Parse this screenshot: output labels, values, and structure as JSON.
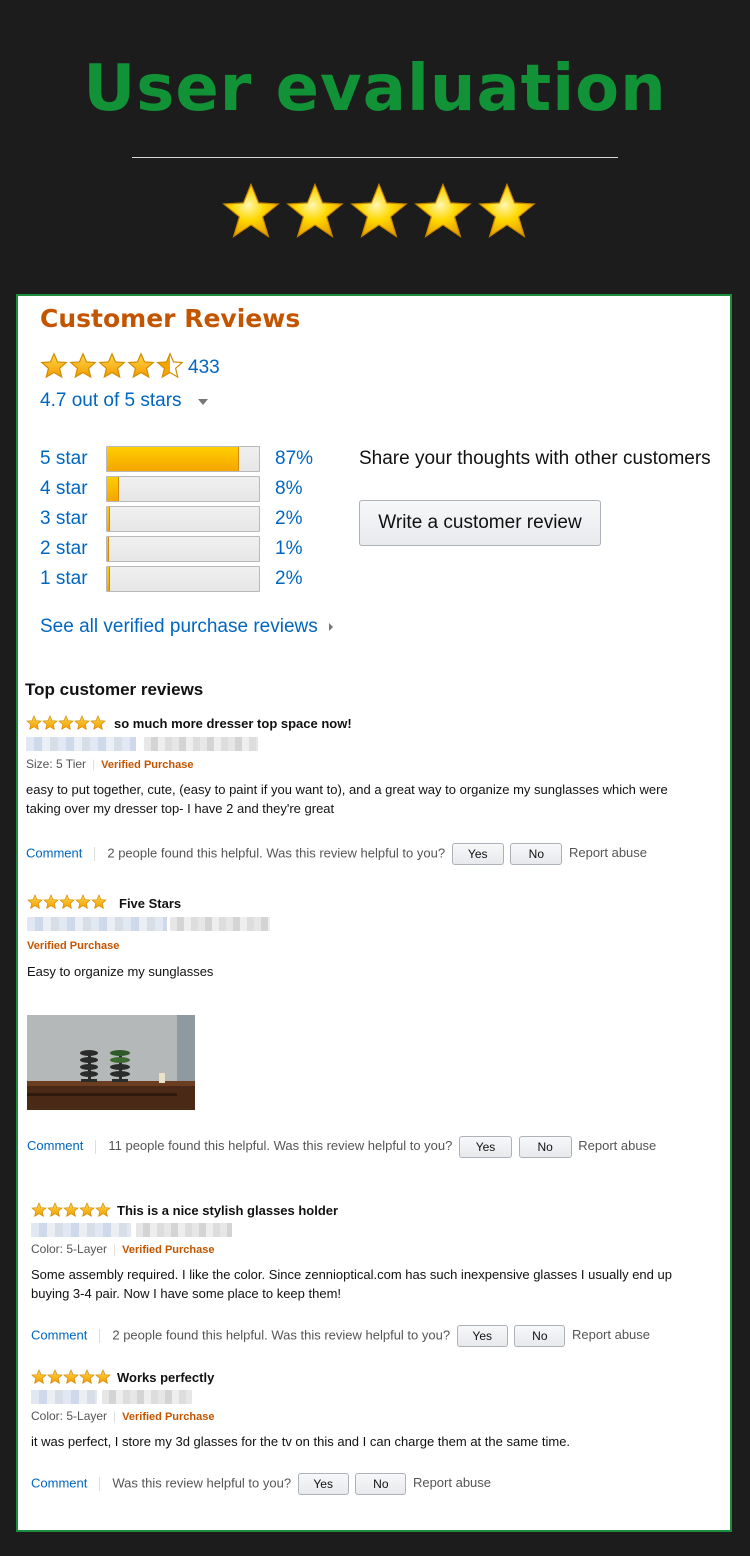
{
  "hero": {
    "title": "User evaluation",
    "star_count": 5
  },
  "reviews_section": {
    "title": "Customer Reviews",
    "rating_stars": 4.5,
    "count": "433",
    "average": "4.7 out of 5 stars",
    "histogram": [
      {
        "label": "5 star",
        "pct_text": "87%",
        "pct": 87
      },
      {
        "label": "4 star",
        "pct_text": "8%",
        "pct": 8
      },
      {
        "label": "3 star",
        "pct_text": "2%",
        "pct": 2
      },
      {
        "label": "2 star",
        "pct_text": "1%",
        "pct": 1
      },
      {
        "label": "1 star",
        "pct_text": "2%",
        "pct": 2
      }
    ],
    "share_text": "Share your thoughts with other customers",
    "write_button": "Write a customer review",
    "see_all": "See all verified purchase reviews"
  },
  "top_reviews_title": "Top customer reviews",
  "reviews": [
    {
      "title": "so much more dresser top space now!",
      "rating": 5,
      "variant": "Size: 5 Tier",
      "verified": "Verified Purchase",
      "body": "easy to put together, cute, (easy to paint if you want to), and a great way to organize my sunglasses which were taking over my dresser top- I have 2 and they're great",
      "comment": "Comment",
      "helpful": "2 people found this helpful. Was this review helpful to you?",
      "yes": "Yes",
      "no": "No",
      "report": "Report abuse"
    },
    {
      "title": "Five Stars",
      "rating": 5,
      "verified": "Verified Purchase",
      "body": "Easy to organize my sunglasses",
      "comment": "Comment",
      "helpful": "11 people found this helpful. Was this review helpful to you?",
      "yes": "Yes",
      "no": "No",
      "report": "Report abuse"
    },
    {
      "title": "This is a nice stylish glasses holder",
      "rating": 5,
      "variant": "Color: 5-Layer",
      "verified": "Verified Purchase",
      "body": "Some assembly required. I like the color. Since zennioptical.com has such inexpensive glasses I usually end up buying 3-4 pair. Now I have some place to keep them!",
      "comment": "Comment",
      "helpful": "2 people found this helpful. Was this review helpful to you?",
      "yes": "Yes",
      "no": "No",
      "report": "Report abuse"
    },
    {
      "title": "Works perfectly",
      "rating": 5,
      "variant": "Color: 5-Layer",
      "verified": "Verified Purchase",
      "body": "it was perfect, I store my 3d glasses for the tv on this and I can charge them at the same time.",
      "comment": "Comment",
      "helpful": "Was this review helpful to you?",
      "yes": "Yes",
      "no": "No",
      "report": "Report abuse"
    }
  ],
  "colors": {
    "title_green": "#119236",
    "panel_border": "#1c8d3c",
    "amazon_orange": "#c45500",
    "link_blue": "#0066c0",
    "star_gold": "#f5a500"
  }
}
